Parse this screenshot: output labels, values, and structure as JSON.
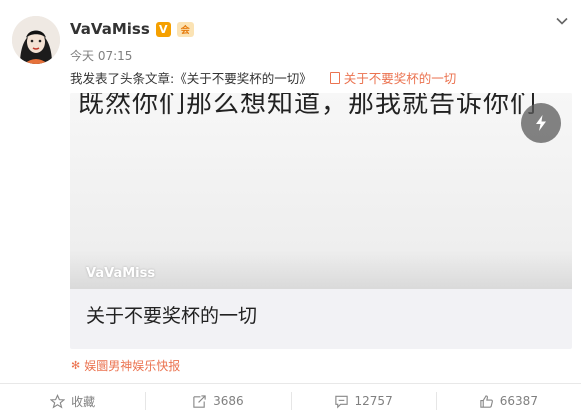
{
  "post": {
    "author": "VaVaMiss",
    "vip_badge": "V",
    "member_badge": "会",
    "time": "今天 07:15",
    "text": "我发表了头条文章:《关于不要奖杯的一切》",
    "article_link": "关于不要奖杯的一切"
  },
  "card": {
    "cover_text": "既然你们那么想知道，那我就告诉你们",
    "cover_author": "VaVaMiss",
    "title": "关于不要奖杯的一切"
  },
  "source": {
    "label": "娱圜男神娱乐快报"
  },
  "actions": {
    "favorite": "收藏",
    "repost": "3686",
    "comment": "12757",
    "like": "66387"
  },
  "colors": {
    "accent": "#eb7350",
    "text": "#333333",
    "muted": "#808080"
  },
  "icons": [
    "avatar",
    "vip-badge",
    "member-badge",
    "chevron-down-icon",
    "doc-icon",
    "lightning-icon",
    "source-icon",
    "star-icon",
    "repost-icon",
    "comment-icon",
    "like-icon"
  ]
}
